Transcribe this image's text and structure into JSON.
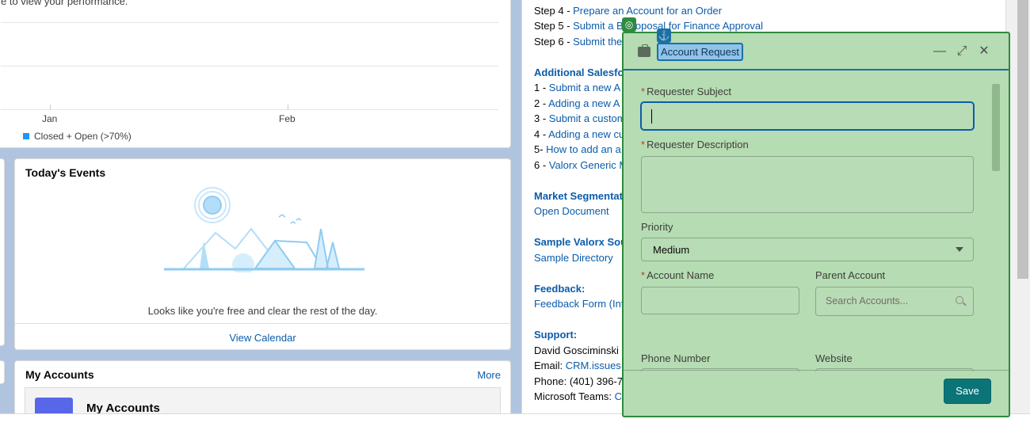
{
  "chart": {
    "subtitle": "e to view your performance.",
    "x_labels": [
      "Jan",
      "Feb"
    ],
    "legend": "Closed + Open (>70%)"
  },
  "events": {
    "title": "Today's Events",
    "message": "Looks like you're free and clear the rest of the day.",
    "view_calendar": "View Calendar"
  },
  "accounts": {
    "title": "My Accounts",
    "more": "More",
    "inner_title": "My Accounts"
  },
  "docs": {
    "steps": [
      {
        "prefix": "Step 4 - ",
        "link": "Prepare an Account for an Order"
      },
      {
        "prefix": "Step 5 - ",
        "link": "Submit a B...roposal for Finance Approval"
      },
      {
        "prefix": "Step 6 - ",
        "link": "Submit the"
      }
    ],
    "additional_head": "Additional Salesfo",
    "additional_items": [
      {
        "prefix": "1 - ",
        "link": "Submit a new A"
      },
      {
        "prefix": "2 - ",
        "link": "Adding a new A"
      },
      {
        "prefix": "3 - ",
        "link": "Submit a custom"
      },
      {
        "prefix": "4 - ",
        "link": "Adding a new cu"
      },
      {
        "prefix": "5- ",
        "link": "How to add an a"
      },
      {
        "prefix": "6 - ",
        "link": "Valorx Generic M"
      }
    ],
    "market_head": "Market Segmentat",
    "market_link": "Open Document",
    "sample_head": "Sample Valorx Sou",
    "sample_link": "Sample Directory",
    "feedback_head": "Feedback:",
    "feedback_link": "Feedback Form (Int",
    "support_head": "Support:",
    "support_name": "David Gosciminski",
    "support_email_label": "Email: ",
    "support_email": "CRM.issues@",
    "support_phone": "Phone: (401) 396-79",
    "support_teams_label": "Microsoft Teams: ",
    "support_teams": "Co"
  },
  "modal": {
    "title": "Account Request",
    "fields": {
      "requester_subject": "Requester Subject",
      "requester_description": "Requester Description",
      "priority": "Priority",
      "priority_value": "Medium",
      "account_name": "Account Name",
      "parent_account": "Parent Account",
      "parent_account_placeholder": "Search Accounts...",
      "phone_number": "Phone Number",
      "website": "Website"
    },
    "save": "Save",
    "required_mark": "*"
  },
  "icons": {
    "minimize": "minimize-icon",
    "expand": "expand-icon",
    "close": "close-icon",
    "anchor": "anchor-icon",
    "target": "target-icon"
  },
  "colors": {
    "link": "#0b5cab",
    "modal_bg": "#b5dcb2",
    "modal_border": "#2e8b3e",
    "save_button": "#0b7477",
    "legend_swatch": "#1b96ff"
  }
}
